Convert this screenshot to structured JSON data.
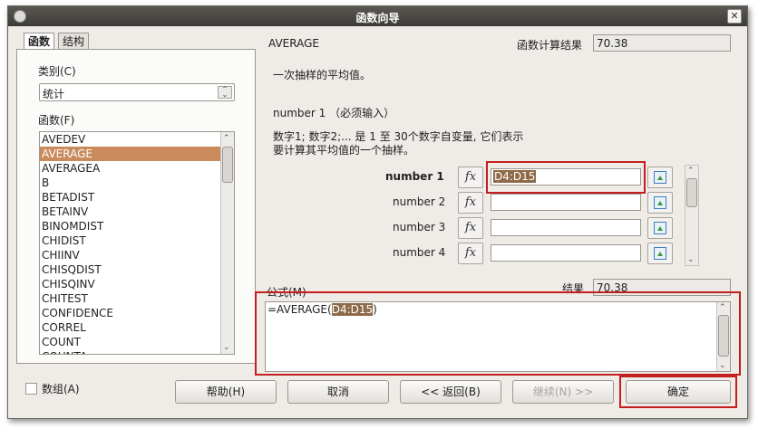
{
  "window": {
    "title": "函数向导",
    "close_glyph": "✕"
  },
  "tabs": [
    {
      "label": "函数"
    },
    {
      "label": "结构"
    }
  ],
  "category": {
    "label": "类别(C)",
    "value": "统计"
  },
  "functions": {
    "label": "函数(F)",
    "items": [
      "AVEDEV",
      "AVERAGE",
      "AVERAGEA",
      "B",
      "BETADIST",
      "BETAINV",
      "BINOMDIST",
      "CHIDIST",
      "CHIINV",
      "CHISQDIST",
      "CHISQINV",
      "CHITEST",
      "CONFIDENCE",
      "CORREL",
      "COUNT",
      "COUNTA"
    ],
    "selected": "AVERAGE"
  },
  "function_name": "AVERAGE",
  "function_result": {
    "label": "函数计算结果",
    "value": "70.38"
  },
  "description": "一次抽样的平均值。",
  "argument_heading": "number 1 （必须输入）",
  "argument_description": [
    "数字1; 数字2;... 是 1 至 30个数字自变量, 它们表示",
    "要计算其平均值的一个抽样。"
  ],
  "arguments": [
    {
      "label": "number 1",
      "value": "D4:D15",
      "fx": "fx"
    },
    {
      "label": "number 2",
      "value": "",
      "fx": "fx"
    },
    {
      "label": "number 3",
      "value": "",
      "fx": "fx"
    },
    {
      "label": "number 4",
      "value": "",
      "fx": "fx"
    }
  ],
  "formula": {
    "label": "公式(M)",
    "prefix": "=AVERAGE(",
    "range": "D4:D15",
    "suffix": ")"
  },
  "result": {
    "label": "结果",
    "value": "70.38"
  },
  "array_checkbox": {
    "label": "数组(A)",
    "checked": false
  },
  "buttons": {
    "help": "帮助(H)",
    "cancel": "取消",
    "back": "<< 返回(B)",
    "next": "继续(N) >>",
    "ok": "确定"
  },
  "accent_colors": {
    "highlight": "#8e6a49",
    "list_selected": "#c98a5c",
    "annotation": "#c41e1e"
  }
}
